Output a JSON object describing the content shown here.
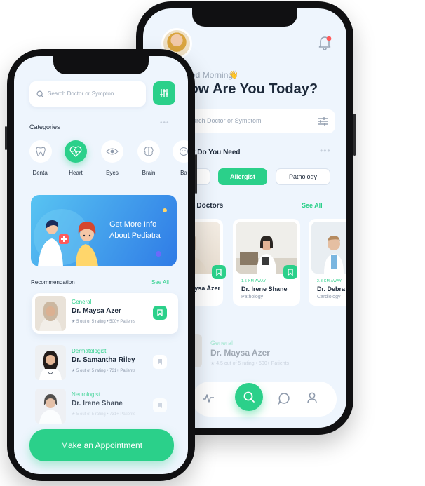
{
  "back_screen": {
    "greeting": "Good Morning,",
    "headline": "How Are You Today?",
    "search": {
      "placeholder": "Search Doctor or Symptom"
    },
    "section_title": "What Do You Need",
    "filters": [
      {
        "label": "",
        "active": false
      },
      {
        "label": "Allergist",
        "active": true
      },
      {
        "label": "Pathology",
        "active": false
      }
    ],
    "top_doctors": {
      "title": "Top Doctors",
      "see_all": "See All",
      "cards": [
        {
          "distance": "",
          "name": "Dr. Maysa Azer",
          "specialty": ""
        },
        {
          "distance": "1.5 KM AWAY",
          "name": "Dr. Irene Shane",
          "specialty": "Pathology"
        },
        {
          "distance": "2.3 KM AWAY",
          "name": "Dr. Debra",
          "specialty": "Cardiology"
        }
      ]
    },
    "faded_card": {
      "specialty": "General",
      "name": "Dr. Maysa Azer",
      "meta": "★ 4.5 out of 5 rating  •  500+ Patients"
    },
    "nav_icons": [
      "activity-icon",
      "search-icon",
      "chat-icon",
      "profile-icon"
    ]
  },
  "front_screen": {
    "search": {
      "placeholder": "Search Doctor or Sympton"
    },
    "categories": {
      "title": "Categories",
      "items": [
        {
          "label": "Dental",
          "icon": "tooth-icon",
          "active": false
        },
        {
          "label": "Heart",
          "icon": "heart-pulse-icon",
          "active": true
        },
        {
          "label": "Eyes",
          "icon": "eye-icon",
          "active": false
        },
        {
          "label": "Brain",
          "icon": "brain-icon",
          "active": false
        },
        {
          "label": "Ba",
          "icon": "baby-icon",
          "active": false
        }
      ]
    },
    "banner": {
      "line1": "Get More Info",
      "line2": "About Pediatra"
    },
    "recommendation": {
      "title": "Recommendation",
      "see_all": "See All",
      "items": [
        {
          "specialty": "General",
          "name": "Dr. Maysa Azer",
          "meta": "★ 5 out of 5 rating  •  500+ Patients",
          "highlighted": true
        },
        {
          "specialty": "Dermatologist",
          "name": "Dr. Samantha Riley",
          "meta": "★ 5 out of 5 rating  •  731+ Patients",
          "highlighted": false
        },
        {
          "specialty": "Neurologist",
          "name": "Dr. Irene Shane",
          "meta": "★ 5 out of 5 rating  •  731+ Patients",
          "highlighted": false
        }
      ]
    },
    "cta_label": "Make an Appointment"
  },
  "colors": {
    "accent": "#2bd08a",
    "screen_bg": "#eef5fd",
    "text_dark": "#1e2a3b",
    "text_muted": "#8d99ab",
    "banner_start": "#58c4f2",
    "banner_end": "#2f7be6",
    "notification_dot": "#ff5b5b"
  }
}
